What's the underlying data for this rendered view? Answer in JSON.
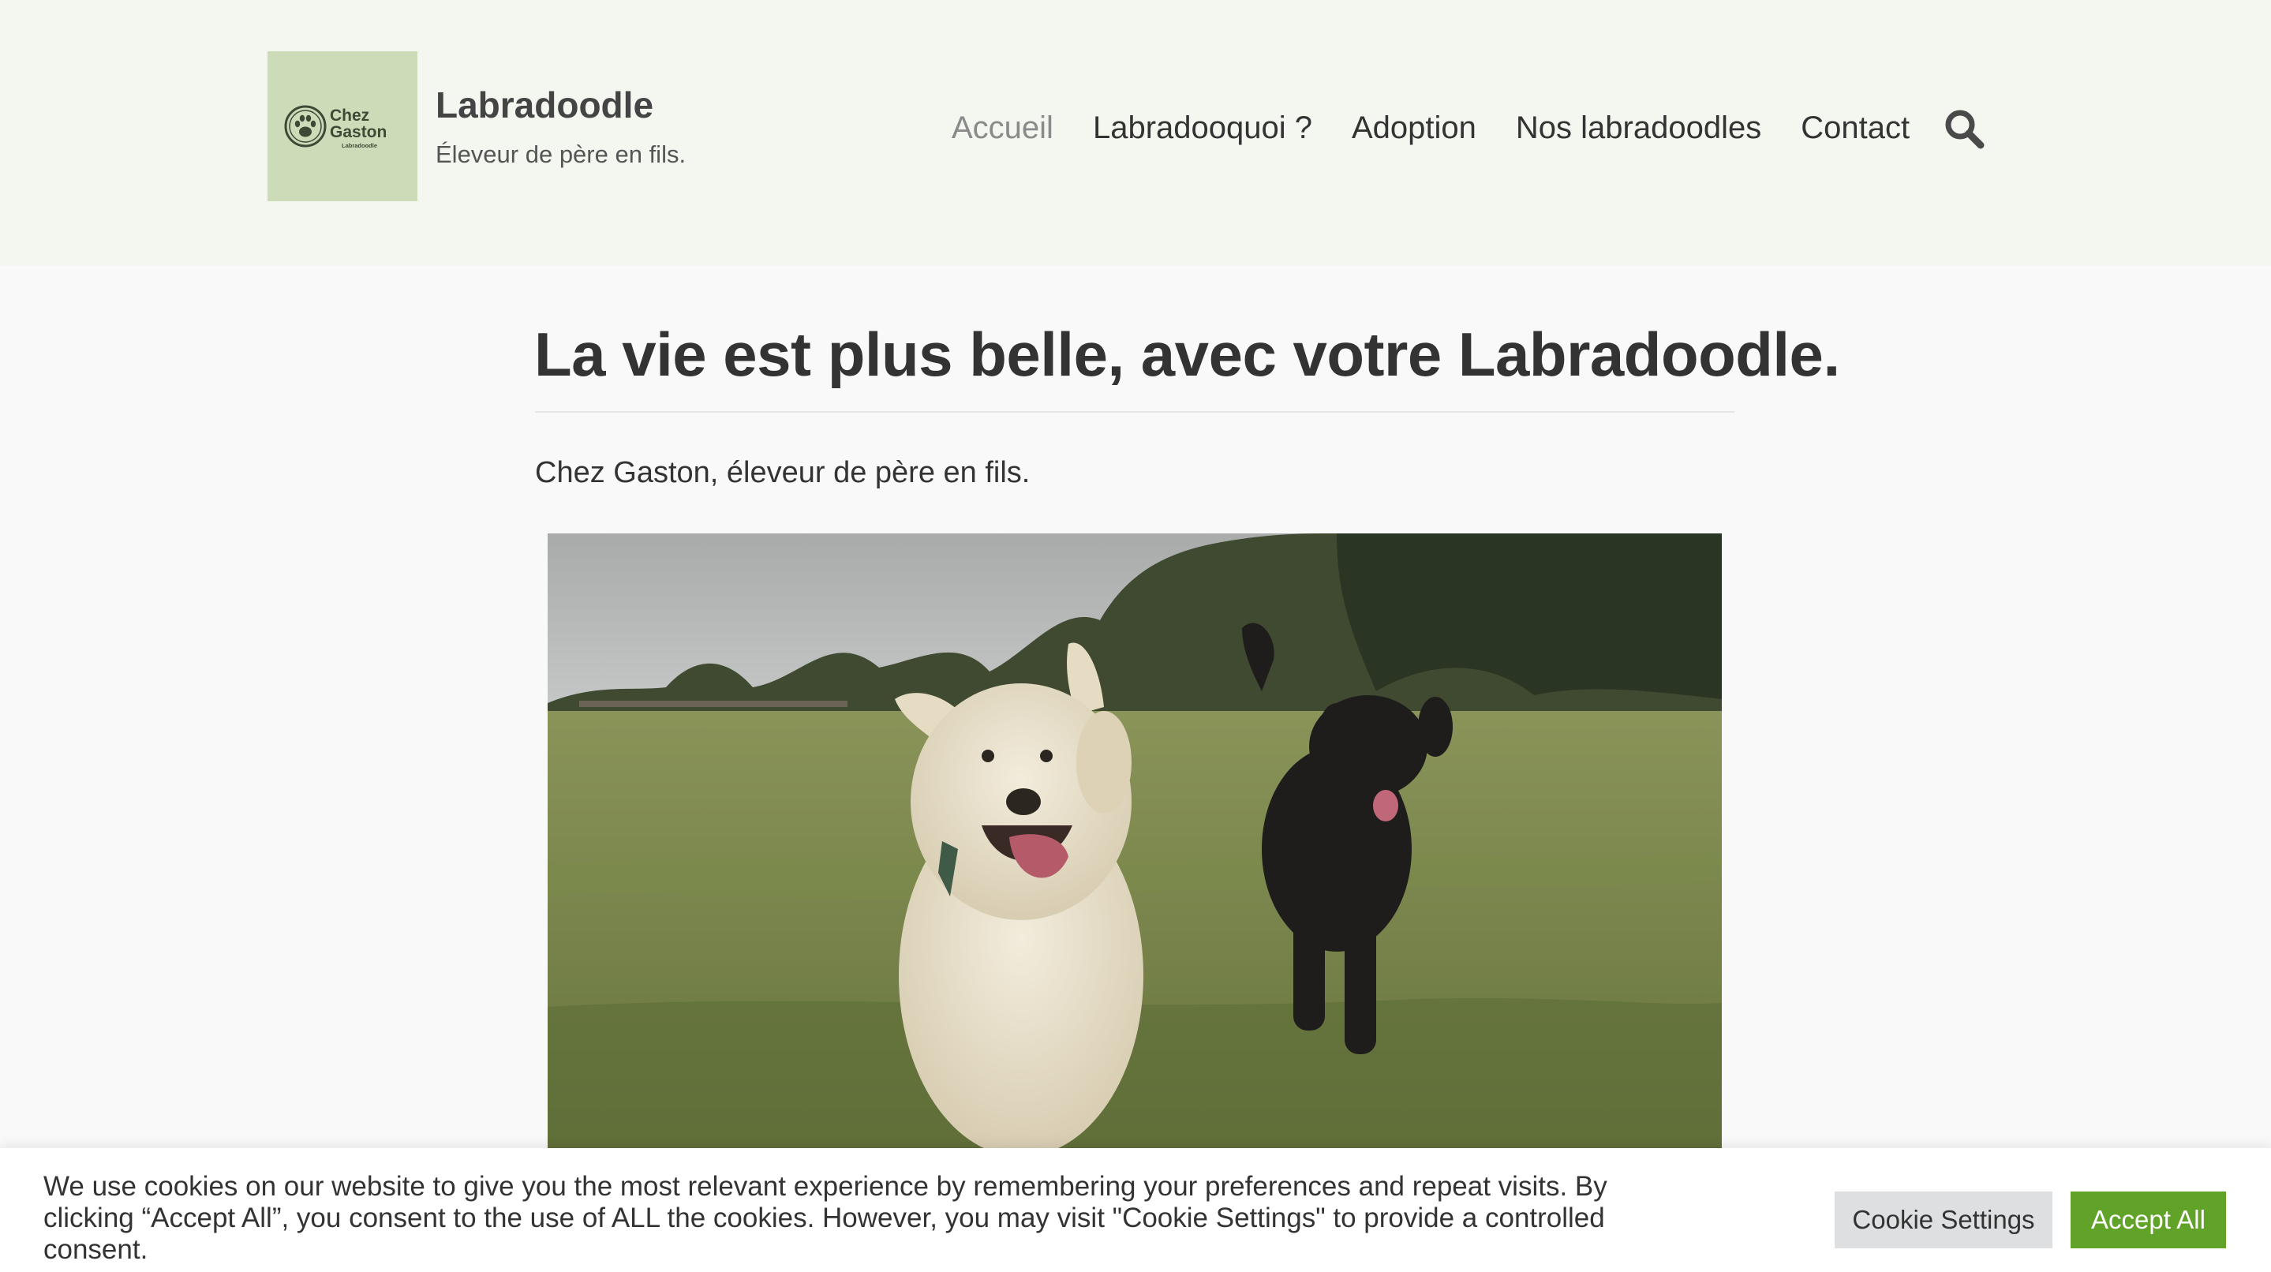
{
  "header": {
    "logo": {
      "line1": "Chez",
      "line2": "Gaston",
      "line3": "Labradoodle"
    },
    "site_title": "Labradoodle",
    "tagline": "Éleveur de père en fils.",
    "nav": [
      {
        "label": "Accueil",
        "active": true
      },
      {
        "label": "Labradooquoi ?",
        "active": false
      },
      {
        "label": "Adoption",
        "active": false
      },
      {
        "label": "Nos labradoodles",
        "active": false
      },
      {
        "label": "Contact",
        "active": false
      }
    ],
    "search_icon": "search-icon"
  },
  "main": {
    "title": "La vie est plus belle, avec votre Labradoodle.",
    "intro": "Chez Gaston, éleveur de père en fils.",
    "hero_image": "photo"
  },
  "cookie_banner": {
    "text": "We use cookies on our website to give you the most relevant experience by remembering your preferences and repeat visits. By clicking “Accept All”, you consent to the use of ALL the cookies. However, you may visit \"Cookie Settings\" to provide a controlled consent.",
    "settings_label": "Cookie Settings",
    "accept_label": "Accept All"
  },
  "colors": {
    "header_bg": "#f4f7f0",
    "logo_bg": "#cddcb8",
    "accept_button": "#61a229",
    "settings_button": "#dedfe0",
    "nav_active": "#8a8a8a"
  }
}
